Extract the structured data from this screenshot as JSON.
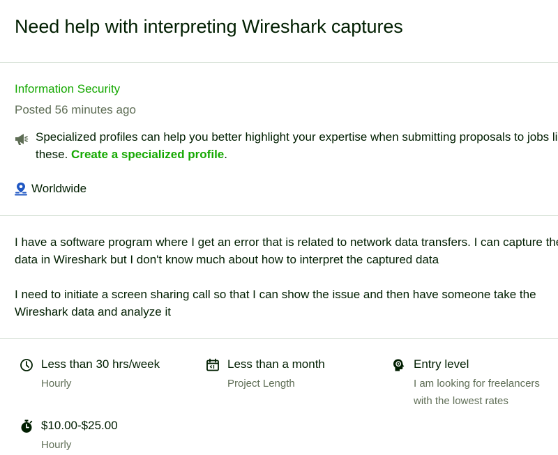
{
  "job": {
    "title": "Need help with interpreting Wireshark captures",
    "category": "Information Security",
    "posted": "Posted 56 minutes ago"
  },
  "promo": {
    "text": "Specialized profiles can help you better highlight your expertise when submitting proposals to jobs like these.",
    "link_label": "Create a specialized profile",
    "suffix": ".",
    "icon": "megaphone-icon"
  },
  "location": {
    "label": "Worldwide",
    "icon": "location-pin-icon"
  },
  "description": {
    "paragraphs": [
      "I have a software program where I get an error that is related to network data transfers. I can capture the data in Wireshark but I don't know much about how to interpret the captured data",
      "I need to initiate a screen sharing call so that I can show the issue and then have someone take the Wireshark data and analyze it"
    ]
  },
  "features": [
    {
      "icon": "clock-icon",
      "title": "Less than 30 hrs/week",
      "subtitle": "Hourly"
    },
    {
      "icon": "calendar-icon",
      "title": "Less than a month",
      "subtitle": "Project Length"
    },
    {
      "icon": "expertise-icon",
      "title": "Entry level",
      "subtitle": "I am looking for freelancers with the lowest rates"
    },
    {
      "icon": "stopwatch-icon",
      "title": "$10.00-$25.00",
      "subtitle": "Hourly"
    }
  ],
  "colors": {
    "accent": "#14a800",
    "text": "#001e00",
    "muted": "#5e6d55",
    "location_icon": "#1f57c3",
    "divider": "#d5e0d5"
  }
}
